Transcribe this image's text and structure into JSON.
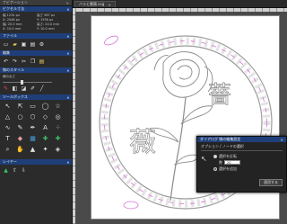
{
  "panel": {
    "title": "ナビゲーション",
    "close": "✕",
    "sections": {
      "size": {
        "title": "ピクセル寸法",
        "rows": [
          [
            "幅 1234 px",
            "高さ 987 px"
          ],
          [
            "X: 2048 px",
            "Y: 1536 px"
          ],
          [
            "幅: 20.0 mm",
            "高さ: 20.0 mm"
          ],
          [
            "X: 10.0 mm",
            "Y: 10.0 mm"
          ]
        ]
      },
      "file": {
        "title": "ファイル"
      },
      "edit": {
        "title": "編集"
      },
      "line": {
        "title": "線のスタイル",
        "label": "線の太さ"
      },
      "tools": {
        "title": "ツールボックス"
      },
      "layer": {
        "title": "レイヤー"
      }
    }
  },
  "document": {
    "tab_title": "バラと薔薇.svg",
    "tab_close": "✕"
  },
  "artwork": {
    "chars": [
      "薔",
      "薇"
    ]
  },
  "dialog": {
    "title": "ダイアログ 線の編集設定",
    "close": "✕",
    "subtitle": "オプション / ノードの選択",
    "options": [
      "選択を反転",
      "選択を追加"
    ],
    "amount_label": "数",
    "amount_value": "20",
    "button": "適用する"
  },
  "colors": {
    "accent": "#1f3f7a",
    "pink": "#d86fd8",
    "rope": "#9c9c9c"
  }
}
